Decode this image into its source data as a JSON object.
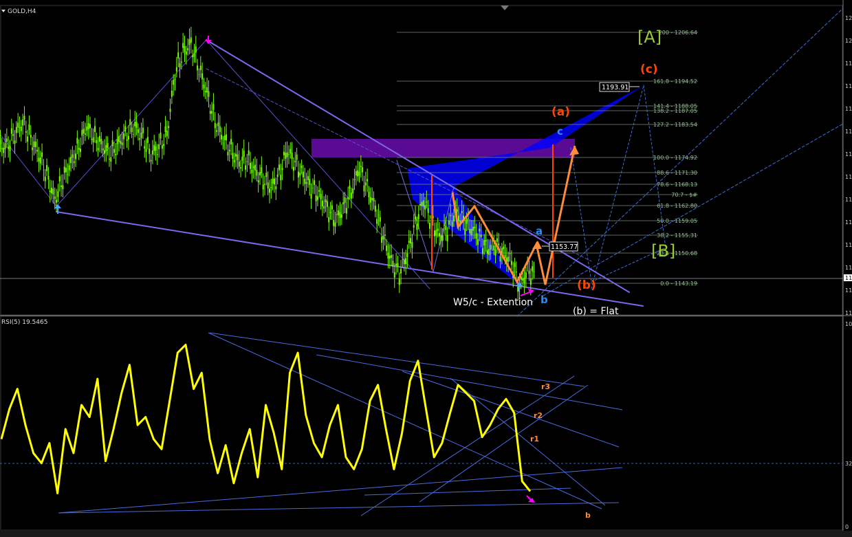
{
  "window": {
    "symbol_label": "GOLD,H4",
    "rsi_label": "RSI(5) 19.5465"
  },
  "price_axis": {
    "visible_tick_labels": [
      "12",
      "12",
      "11",
      "11",
      "11",
      "11",
      "11",
      "11",
      "11",
      "11",
      "11",
      "11",
      "11",
      "11"
    ],
    "current_price_marker": "11"
  },
  "rsi_axis": {
    "tick_labels": [
      "10",
      "32",
      "0"
    ]
  },
  "fibonacci_levels": [
    {
      "label": "200 - 1206.64"
    },
    {
      "label": "161.8 - 1194.52"
    },
    {
      "label": "141.4 - 1188.05"
    },
    {
      "label": "138.2 - 1187.05"
    },
    {
      "label": "127.2 - 1183.54"
    },
    {
      "label": "100.0 - 1174.92"
    },
    {
      "label": "88.6 - 1171.30"
    },
    {
      "label": "78.6 - 1168.13"
    },
    {
      "label": "70.7 - $#"
    },
    {
      "label": "61.8 - 1162.80"
    },
    {
      "label": "50.0 - 1159.05"
    },
    {
      "label": "38.2 - 1155.31"
    },
    {
      "label": "23.6 - 1150.68"
    },
    {
      "label": "0.0 - 1143.19"
    }
  ],
  "price_boxes": {
    "upper": "1193.91",
    "lower": "1153.77"
  },
  "wave_labels": {
    "big_A": "[A]",
    "big_B": "[B]",
    "c_paren": "(c)",
    "a_paren": "(a)",
    "b_paren": "(b)",
    "small_c": "c",
    "small_a": "a",
    "small_b": "b"
  },
  "annotations": {
    "w5c": "W5/c - Extention",
    "flat": "(b) = Flat"
  },
  "rsi_labels": {
    "r3": "r3",
    "r2": "r2",
    "r1": "r1",
    "b": "b"
  },
  "colors": {
    "background": "#000000",
    "candles": "#7CFC00",
    "rsi_line": "#FFFF00",
    "trendlines": "#7B68EE",
    "harmonic_fill": "#0000FF",
    "resistance_zone": "#6A0DAD",
    "wave_path": "#FF8C3A",
    "fib_text": "#8FBC8F",
    "cyan_label": "#1E90FF",
    "green_label": "#9ACD32",
    "orange_label": "#FF4500"
  },
  "chart_data": [
    {
      "type": "candlestick",
      "title": "GOLD,H4",
      "series": [
        {
          "values": [
            1178,
            1181,
            1184,
            1180,
            1176,
            1171,
            1165,
            1170,
            1174,
            1178,
            1183,
            1180,
            1178,
            1176,
            1179,
            1181,
            1183,
            1180,
            1176,
            1178,
            1181,
            1196,
            1201,
            1203,
            1197,
            1191,
            1184,
            1180,
            1177,
            1174,
            1175,
            1172,
            1170,
            1168,
            1171,
            1177,
            1174,
            1171,
            1168,
            1166,
            1163,
            1160,
            1163,
            1167,
            1173,
            1168,
            1163,
            1156,
            1150,
            1147,
            1152,
            1159,
            1165,
            1160,
            1156,
            1158,
            1162,
            1160,
            1158,
            1156,
            1153,
            1154,
            1152,
            1150,
            1144,
            1148,
            1146
          ]
        }
      ]
    },
    {
      "type": "line",
      "title": "RSI(5) 19.5465",
      "ylim": [
        0,
        100
      ],
      "series": [
        {
          "values": [
            45,
            60,
            70,
            52,
            38,
            33,
            43,
            18,
            50,
            38,
            62,
            56,
            75,
            34,
            50,
            68,
            82,
            52,
            56,
            45,
            40,
            64,
            88,
            92,
            70,
            78,
            45,
            28,
            42,
            23,
            38,
            50,
            26,
            62,
            48,
            30,
            78,
            88,
            57,
            43,
            36,
            52,
            62,
            36,
            30,
            40,
            64,
            72,
            50,
            30,
            48,
            74,
            84,
            60,
            36,
            43,
            58,
            72,
            68,
            64,
            46,
            52,
            60,
            65,
            58,
            24,
            19
          ]
        }
      ]
    }
  ]
}
